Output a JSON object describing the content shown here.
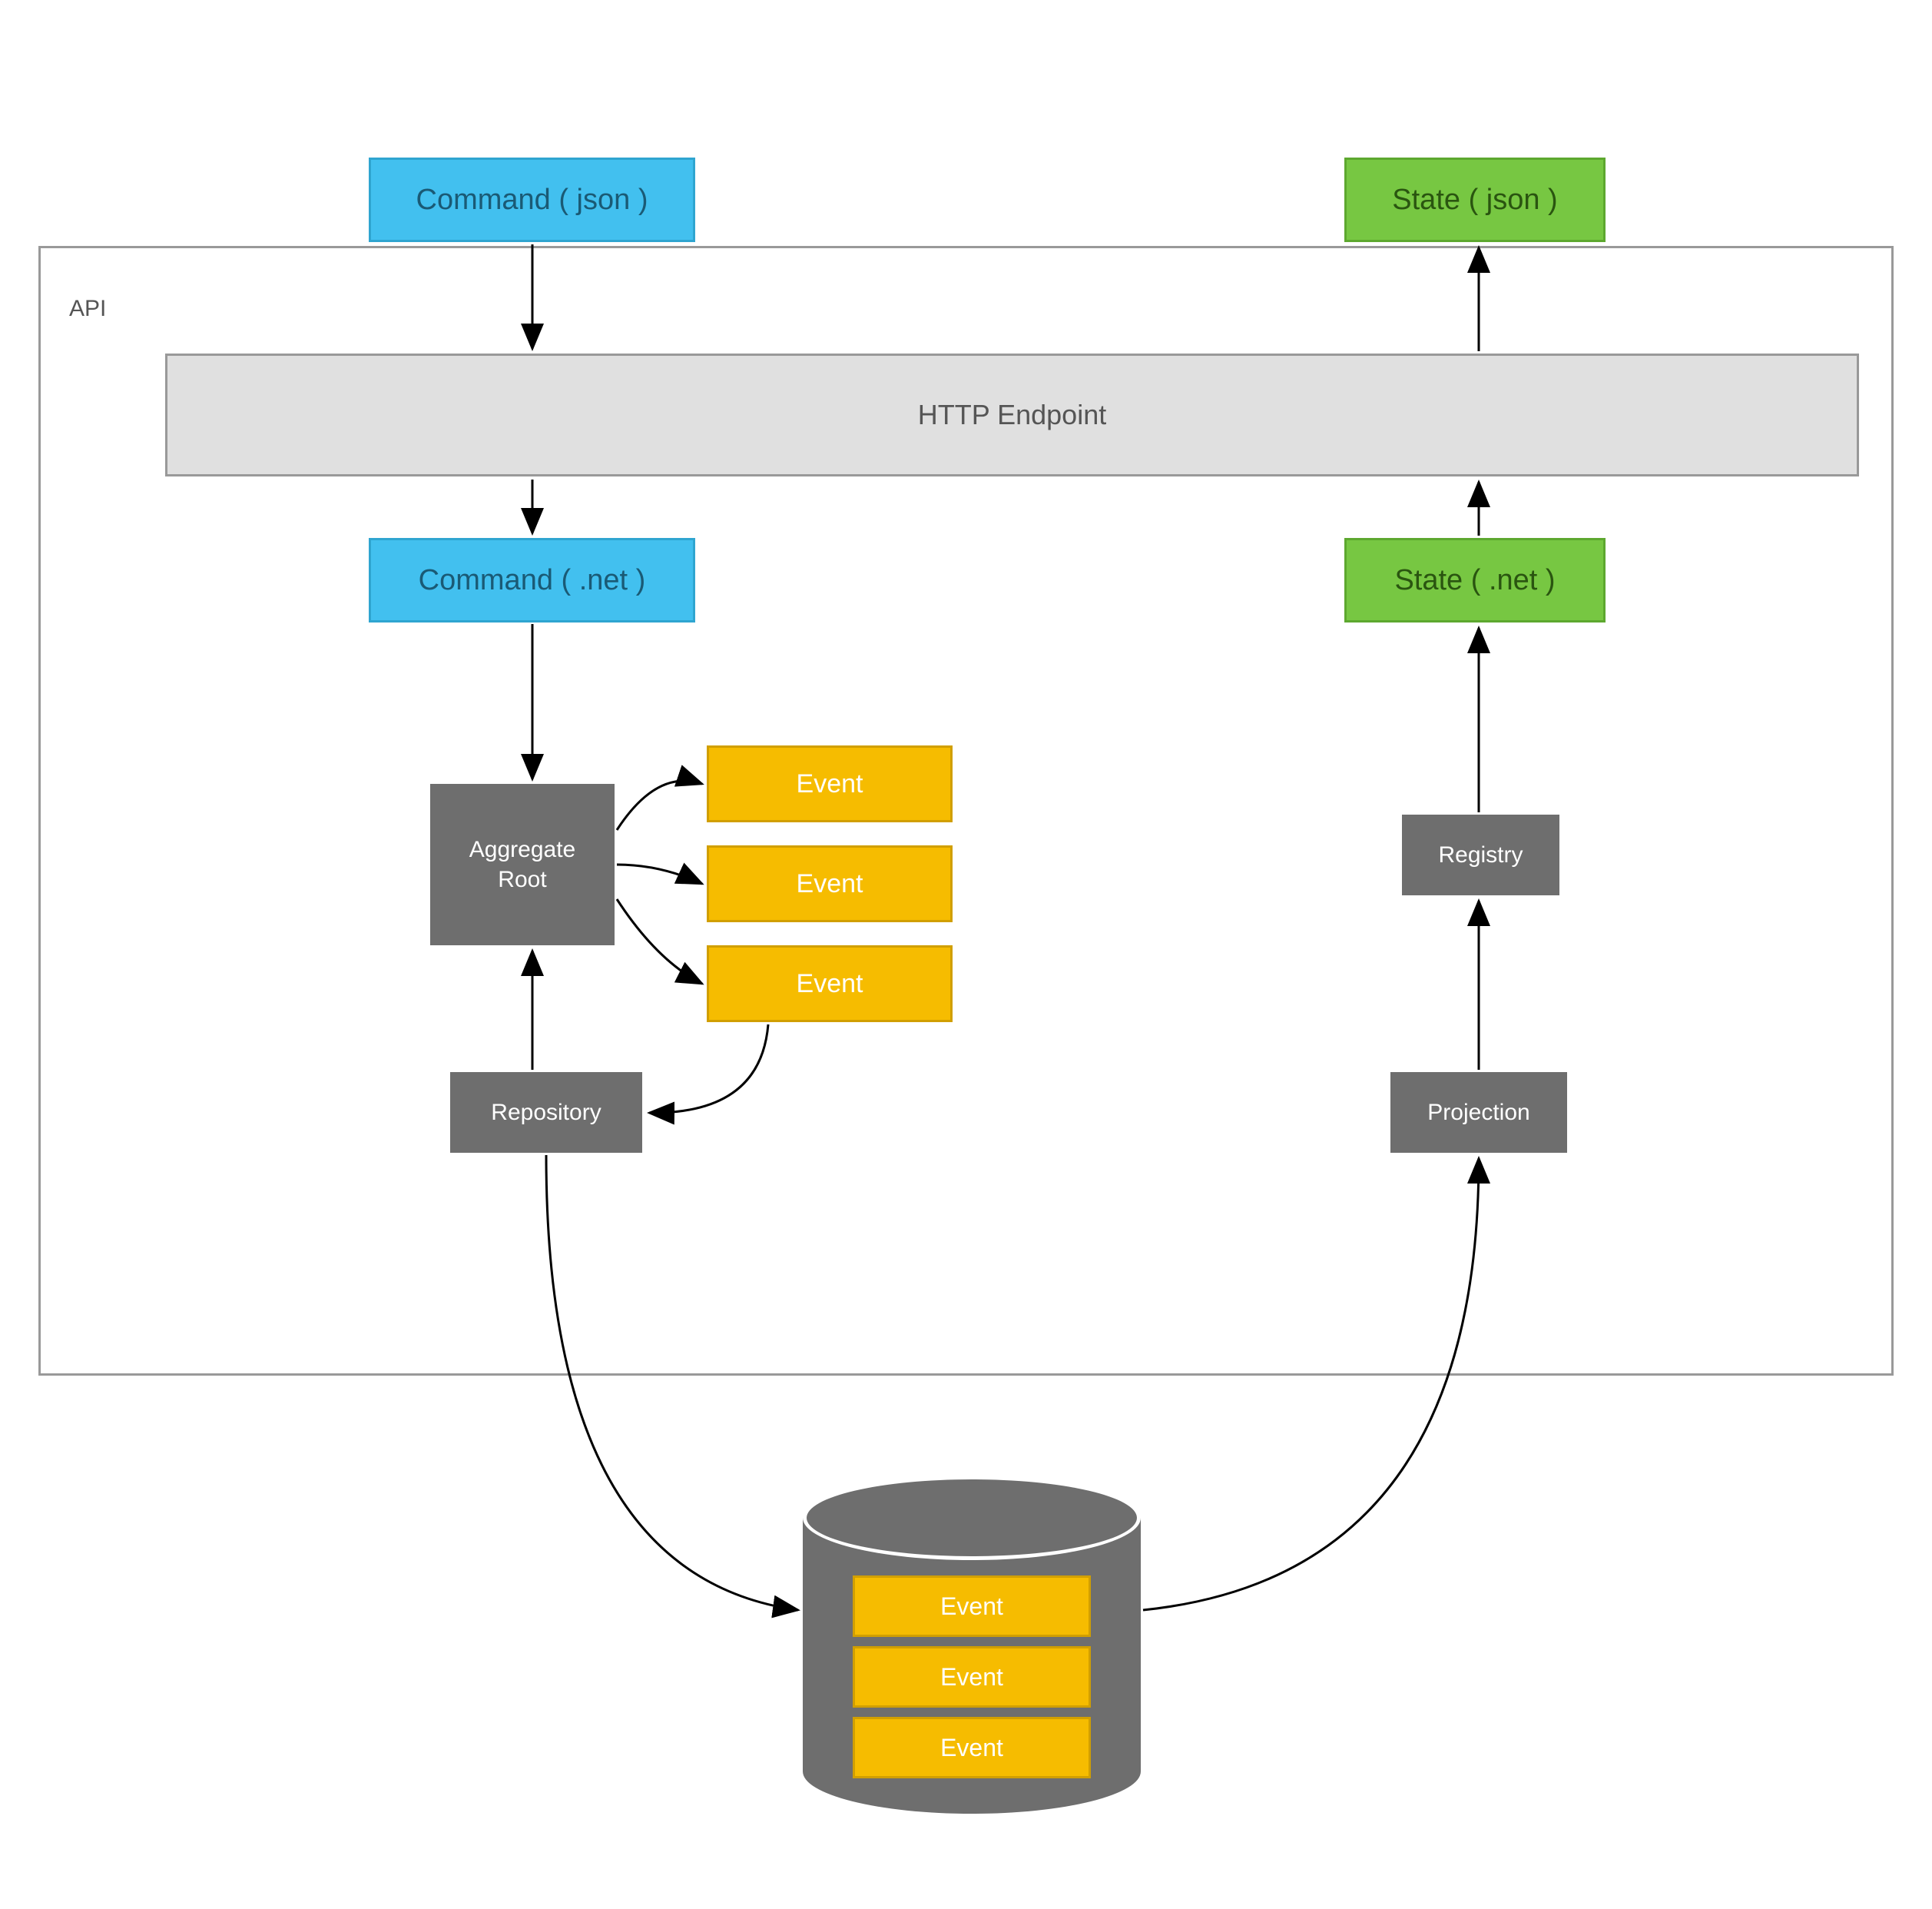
{
  "api": {
    "label": "API",
    "http_endpoint": "HTTP Endpoint"
  },
  "command": {
    "json": "Command ( json )",
    "net": "Command ( .net )"
  },
  "state": {
    "json": "State ( json )",
    "net": "State ( .net )"
  },
  "gray": {
    "aggregate_root_line1": "Aggregate",
    "aggregate_root_line2": "Root",
    "repository": "Repository",
    "registry": "Registry",
    "projection": "Projection"
  },
  "events": {
    "e1": "Event",
    "e2": "Event",
    "e3": "Event"
  },
  "db": {
    "e1": "Event",
    "e2": "Event",
    "e3": "Event"
  }
}
